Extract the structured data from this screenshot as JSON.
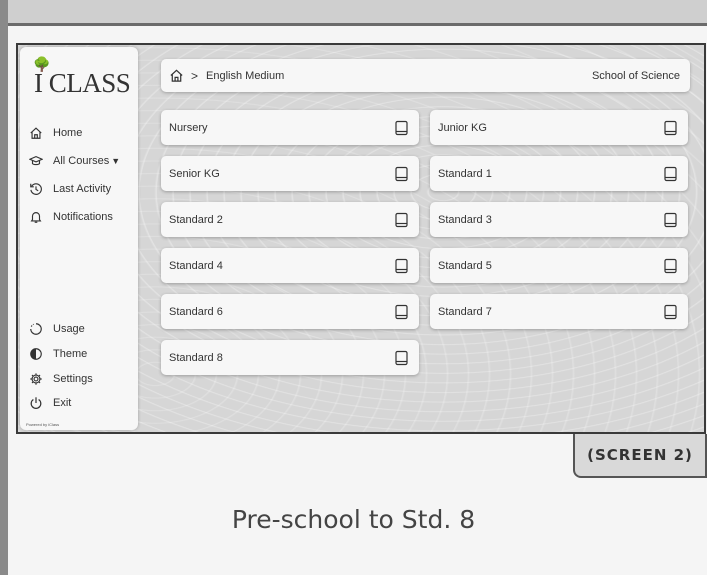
{
  "app": {
    "logo_text": "I CLASS",
    "powered_by": "Powered by iClass"
  },
  "sidebar": {
    "top_items": [
      {
        "label": "Home",
        "icon": "home-icon"
      },
      {
        "label": "All Courses",
        "icon": "graduation-cap-icon",
        "has_dropdown": true
      },
      {
        "label": "Last Activity",
        "icon": "history-icon"
      },
      {
        "label": "Notifications",
        "icon": "bell-icon"
      }
    ],
    "bottom_items": [
      {
        "label": "Usage",
        "icon": "usage-icon"
      },
      {
        "label": "Theme",
        "icon": "theme-icon"
      },
      {
        "label": "Settings",
        "icon": "gear-icon"
      },
      {
        "label": "Exit",
        "icon": "power-icon"
      }
    ]
  },
  "breadcrumb": {
    "separator": ">",
    "current": "English Medium",
    "school": "School of Science"
  },
  "courses": [
    {
      "label": "Nursery"
    },
    {
      "label": "Junior KG"
    },
    {
      "label": "Senior KG"
    },
    {
      "label": "Standard 1"
    },
    {
      "label": "Standard 2"
    },
    {
      "label": "Standard 3"
    },
    {
      "label": "Standard 4"
    },
    {
      "label": "Standard 5"
    },
    {
      "label": "Standard 6"
    },
    {
      "label": "Standard 7"
    },
    {
      "label": "Standard 8"
    }
  ],
  "screen_tag": "(SCREEN 2)",
  "caption": "Pre-school to Std. 8",
  "colors": {
    "background": "#d6d6d6",
    "card": "#f7f7f7",
    "text": "#333333"
  }
}
